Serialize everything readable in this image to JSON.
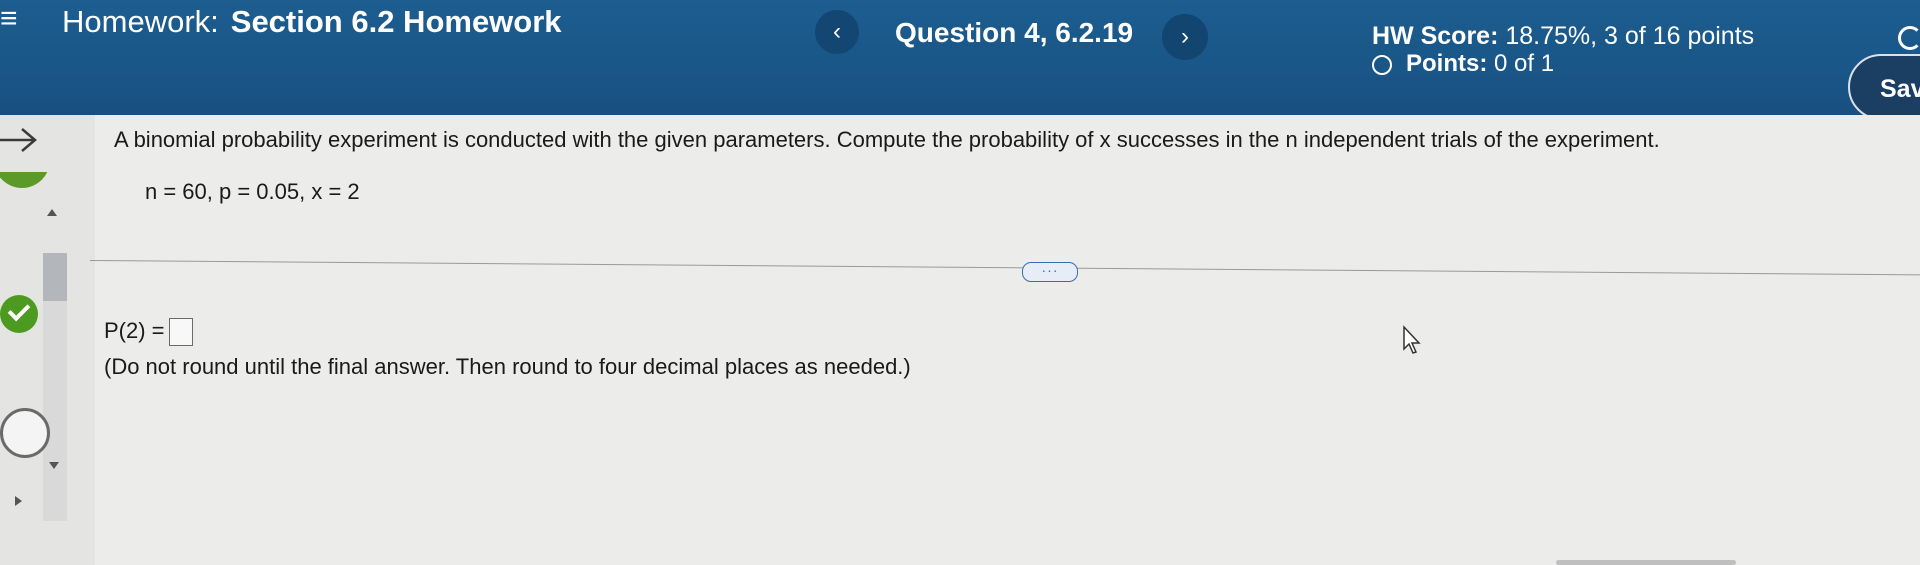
{
  "header": {
    "menu_icon": "hamburger-icon",
    "homework_label": "Homework:",
    "homework_name": "Section 6.2 Homework",
    "prev_icon": "chevron-left-icon",
    "prev_glyph": "‹",
    "question": "Question 4, 6.2.19",
    "next_icon": "chevron-right-icon",
    "next_glyph": "›",
    "score_label": "HW Score:",
    "score_value": "18.75%, 3 of 16 points",
    "points_label": "Points:",
    "points_value": "0 of 1",
    "save_label": "Sav"
  },
  "question": {
    "prompt": "A binomial probability experiment is conducted with the given parameters. Compute the probability of x successes in the n independent trials of the experiment.",
    "parameters": "n = 60, p = 0.05, x = 2",
    "more_glyph": "···",
    "answer_label": "P(2) =",
    "answer_value": "",
    "instructions": "(Do not round until the final answer. Then round to four decimal places as needed.)"
  },
  "colors": {
    "header_bg": "#1a5688",
    "success_green": "#4d9a21",
    "link_blue": "#3a6db0"
  }
}
